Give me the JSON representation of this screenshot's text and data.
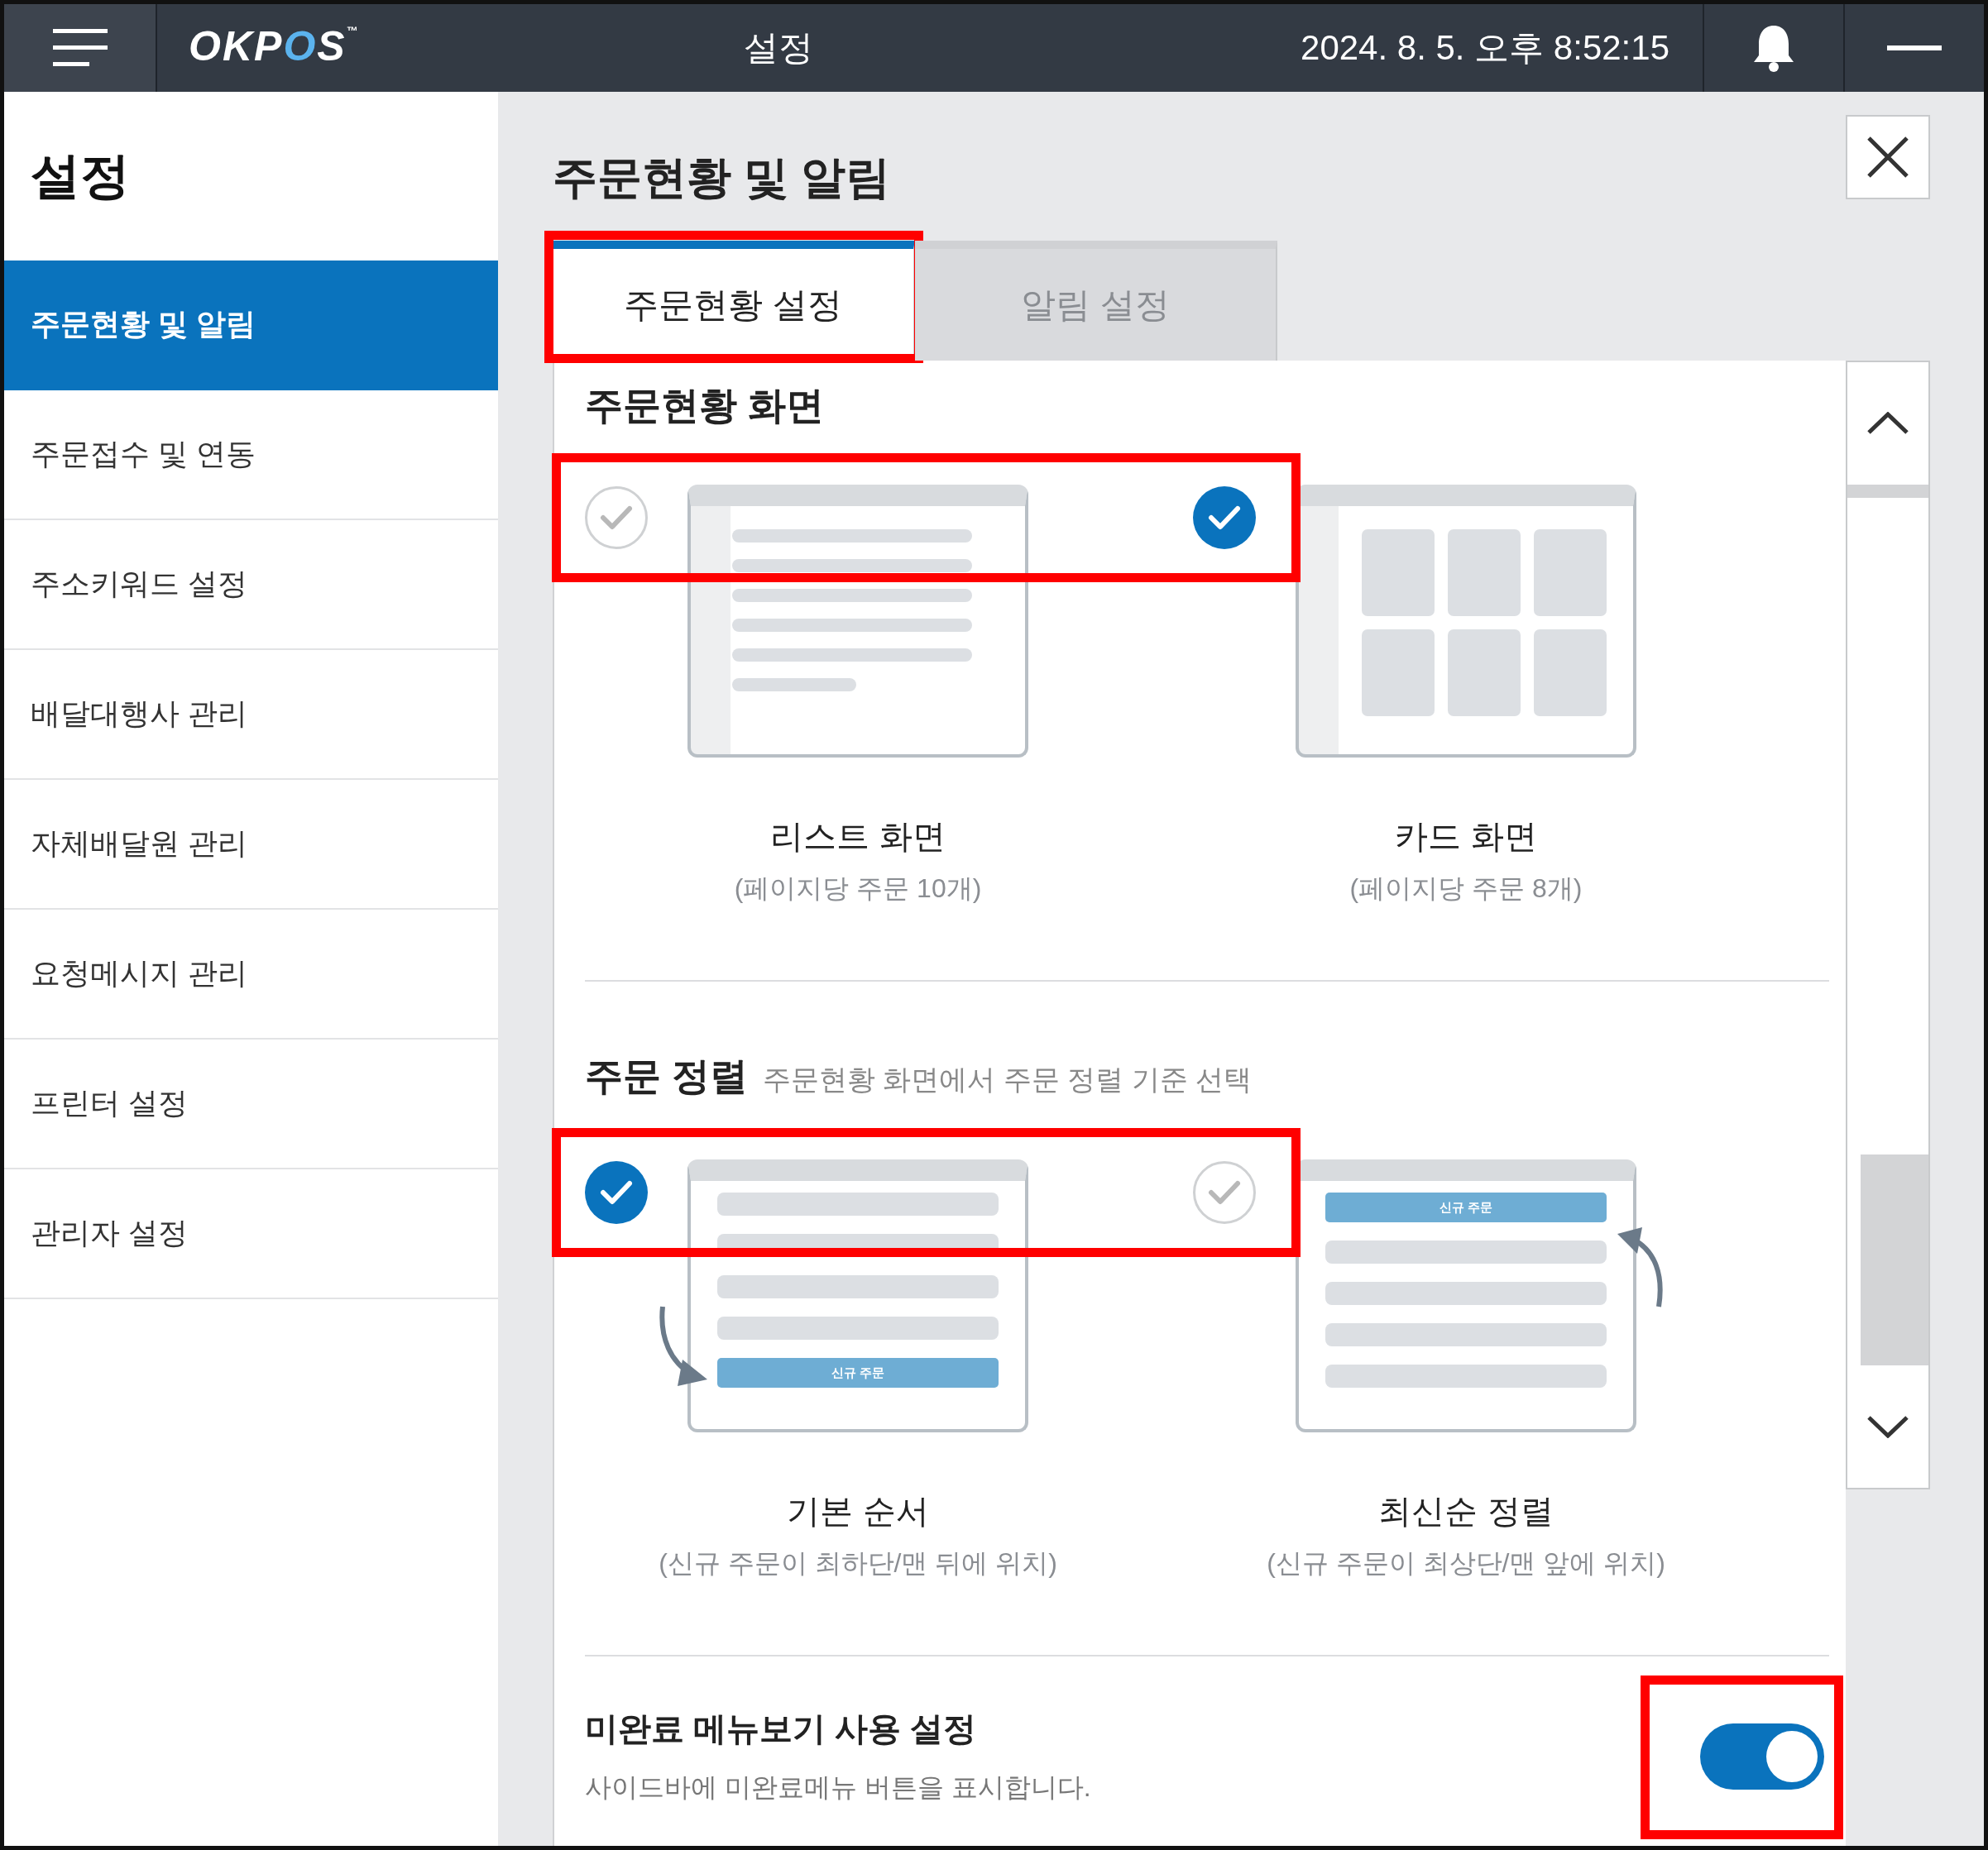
{
  "header": {
    "logo": {
      "text": "OKPOS",
      "mark": "™"
    },
    "title": "설정",
    "datetime": "2024. 8. 5. 오후 8:52:15"
  },
  "sidebar": {
    "title": "설정",
    "items": [
      {
        "label": "주문현황 및 알림",
        "selected": true
      },
      {
        "label": "주문접수 및 연동",
        "selected": false
      },
      {
        "label": "주소키워드 설정",
        "selected": false
      },
      {
        "label": "배달대행사 관리",
        "selected": false
      },
      {
        "label": "자체배달원 관리",
        "selected": false
      },
      {
        "label": "요청메시지 관리",
        "selected": false
      },
      {
        "label": "프린터 설정",
        "selected": false
      },
      {
        "label": "관리자 설정",
        "selected": false
      }
    ]
  },
  "page": {
    "title": "주문현황 및 알림"
  },
  "tabs": [
    {
      "label": "주문현황 설정",
      "selected": true,
      "highlighted": true
    },
    {
      "label": "알림 설정",
      "selected": false,
      "highlighted": false
    }
  ],
  "sections": [
    {
      "kind": "options",
      "title": "주문현황 화면",
      "highlighted": true,
      "options": [
        {
          "kind": "list",
          "label": "리스트 화면",
          "note": "(페이지당 주문 10개)",
          "selected": false
        },
        {
          "kind": "cards",
          "label": "카드 화면",
          "note": "(페이지당 주문 8개)",
          "selected": true
        }
      ]
    },
    {
      "kind": "options",
      "title": "주문 정렬",
      "subtitle": "주문현황 화면에서 주문 정렬 기준 선택",
      "highlighted": true,
      "options": [
        {
          "kind": "append",
          "label": "기본 순서",
          "note": "(신규 주문이 최하단/맨 뒤에 위치)",
          "selected": true,
          "badge": "신규 주문"
        },
        {
          "kind": "prepend",
          "label": "최신순 정렬",
          "note": "(신규 주문이 최상단/맨 앞에 위치)",
          "selected": false,
          "badge": "신규 주문"
        }
      ]
    },
    {
      "kind": "toggle",
      "title": "미완료 메뉴보기 사용 설정",
      "description": "사이드바에 미완료메뉴 버튼을 표시합니다.",
      "on": true,
      "highlighted": true
    }
  ]
}
